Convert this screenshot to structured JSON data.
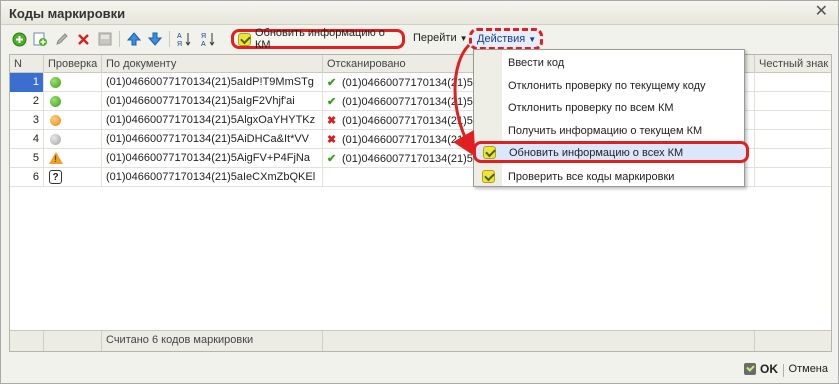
{
  "window": {
    "title": "Коды маркировки",
    "close_glyph": "✕"
  },
  "toolbar": {
    "icons": [
      "add-icon",
      "add-copy-icon",
      "edit-icon",
      "delete-icon",
      "disabled-icon",
      "move-up-icon",
      "move-down-icon",
      "sort-asc-icon",
      "sort-desc-icon"
    ],
    "refresh_label": "Обновить информацию о КМ",
    "goto_label": "Перейти",
    "actions_label": "Действия"
  },
  "grid": {
    "columns": [
      "N",
      "Проверка",
      "По документу",
      "Отсканировано",
      "Честный знак"
    ],
    "rows": [
      {
        "n": "1",
        "check": "green",
        "doc": "(01)04660077170134(21)5aIdP!T9MmSTg",
        "scanned_status": "ok",
        "scanned": "(01)04660077170134(21)5a"
      },
      {
        "n": "2",
        "check": "green",
        "doc": "(01)04660077170134(21)5aIgF2Vhjf'ai",
        "scanned_status": "ok",
        "scanned": "(01)04660077170134(21)5a"
      },
      {
        "n": "3",
        "check": "orange",
        "doc": "(01)04660077170134(21)5AlgxOaYHYTKz",
        "scanned_status": "bad",
        "scanned": "(01)04660077170134(21)5a"
      },
      {
        "n": "4",
        "check": "gray",
        "doc": "(01)04660077170134(21)5AiDHCa&It*VV",
        "scanned_status": "bad",
        "scanned": "(01)04660077170134(21)5a"
      },
      {
        "n": "5",
        "check": "warning",
        "doc": "(01)04660077170134(21)5AigFV+P4FjNa",
        "scanned_status": "ok",
        "scanned": "(01)04660077170134(21)5a"
      },
      {
        "n": "6",
        "check": "unknown",
        "doc": "(01)04660077170134(21)5aIeCXmZbQKEl",
        "scanned_status": "",
        "scanned": ""
      }
    ],
    "footer_text": "Считано 6 кодов маркировки"
  },
  "menu": {
    "items": [
      {
        "label": "Ввести код",
        "icon": ""
      },
      {
        "label": "Отклонить проверку по текущему коду",
        "icon": ""
      },
      {
        "label": "Отклонить проверку по всем КМ",
        "icon": ""
      },
      {
        "label": "Получить информацию о текущем КМ",
        "icon": ""
      },
      {
        "label": "Обновить информацию о всех КМ",
        "icon": "km-check-icon"
      },
      {
        "label": "Проверить все коды маркировки",
        "icon": "km-check-icon"
      }
    ]
  },
  "buttons": {
    "ok_label": "OK",
    "cancel_label": "Отмена"
  },
  "colors": {
    "highlight_red": "#e02020",
    "selection_blue": "#3a6fd0"
  }
}
